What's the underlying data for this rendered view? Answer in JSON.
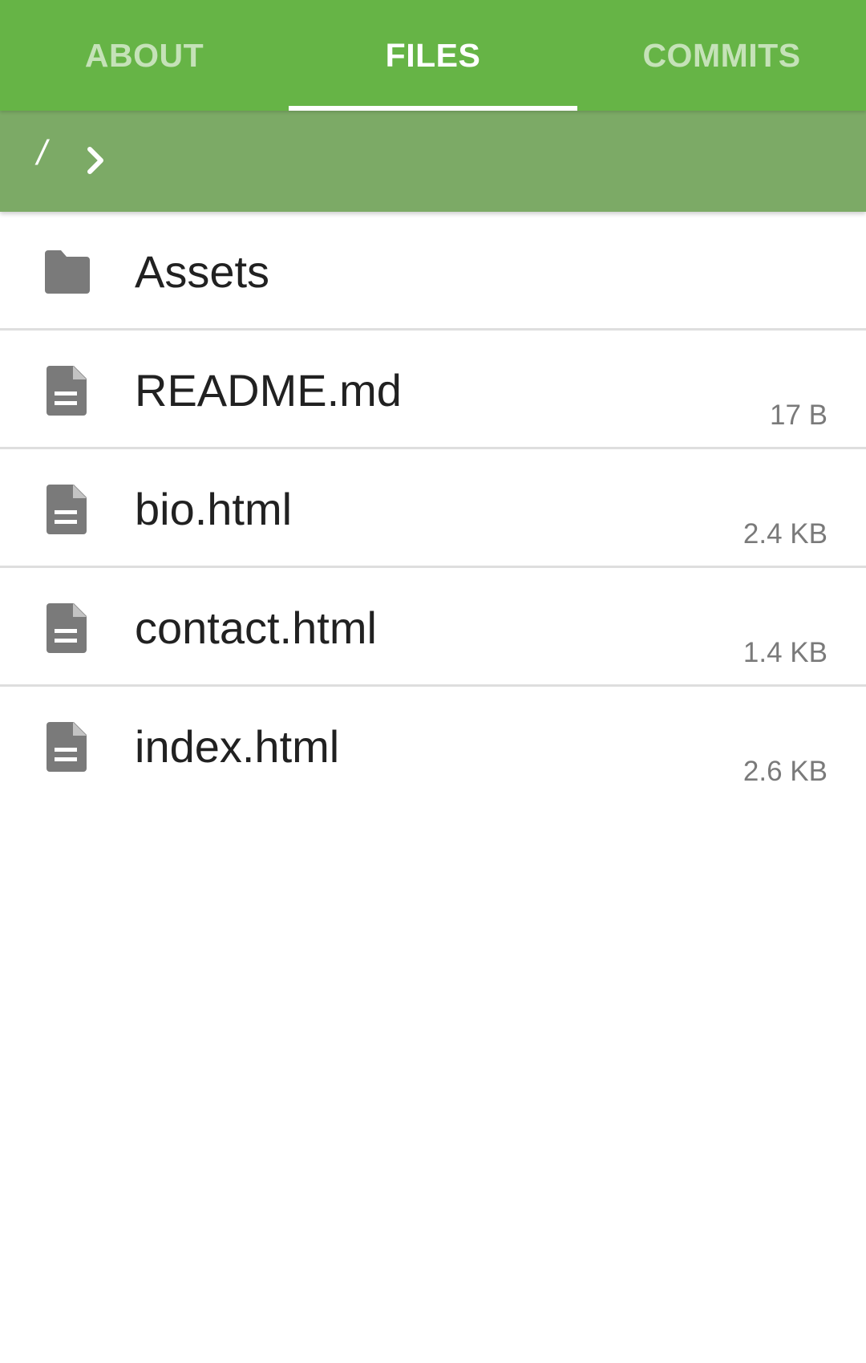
{
  "tabs": [
    {
      "label": "ABOUT",
      "active": false
    },
    {
      "label": "FILES",
      "active": true
    },
    {
      "label": "COMMITS",
      "active": false
    }
  ],
  "path": {
    "root": "/",
    "separator_icon": "chevron-right-icon"
  },
  "files": [
    {
      "name": "Assets",
      "size": "",
      "icon": "folder-icon"
    },
    {
      "name": "README.md",
      "size": "17 B",
      "icon": "file-icon"
    },
    {
      "name": "bio.html",
      "size": "2.4 KB",
      "icon": "file-icon"
    },
    {
      "name": "contact.html",
      "size": "1.4 KB",
      "icon": "file-icon"
    },
    {
      "name": "index.html",
      "size": "2.6 KB",
      "icon": "file-icon"
    }
  ],
  "colors": {
    "tab_bar": "#66b446",
    "path_bar": "#7caa66",
    "icon": "#7a7a7a",
    "text": "#212121",
    "secondary_text": "#7a7a7a"
  }
}
